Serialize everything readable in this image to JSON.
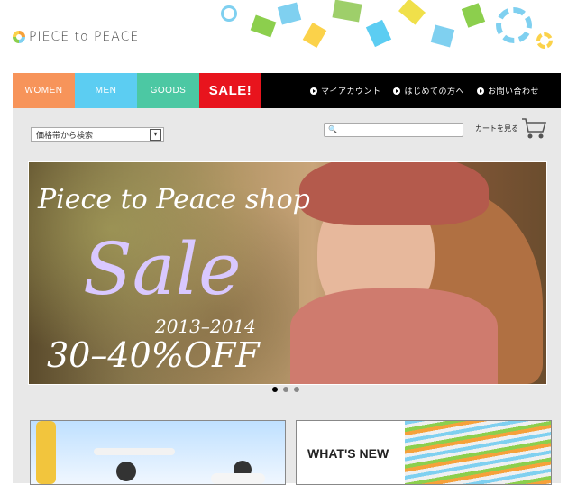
{
  "header": {
    "logo_text": "PIECE to PEACE"
  },
  "nav": {
    "women": "WOMEN",
    "men": "MEN",
    "goods": "GOODS",
    "sale": "SALE!",
    "right": [
      "マイアカウント",
      "はじめての方へ",
      "お問い合わせ"
    ]
  },
  "toolbar": {
    "price_select": "価格帯から検索",
    "search_placeholder": "",
    "cart_label": "カートを見る"
  },
  "hero": {
    "line1": "Piece to Peace shop",
    "line2": "Sale",
    "line3": "2013–2014",
    "line4": "30–40%OFF",
    "slides": 3,
    "active_slide": 0
  },
  "promo": {
    "whats_new": "WHAT'S NEW"
  },
  "colors": {
    "women": "#f7945a",
    "men": "#5ccdf2",
    "goods": "#4cc8a3",
    "sale": "#e8141d"
  }
}
